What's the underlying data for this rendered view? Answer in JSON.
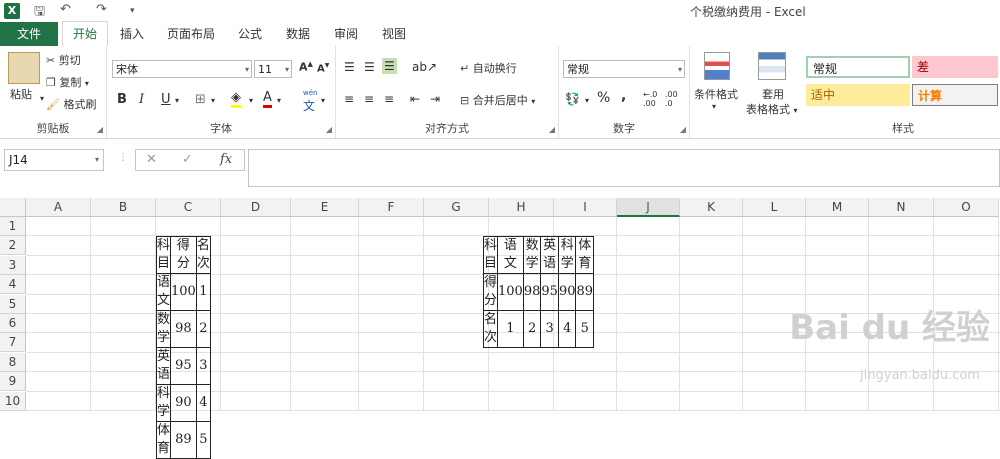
{
  "window": {
    "title": "个税缴纳费用 - Excel",
    "app_icon": "X"
  },
  "tabs": {
    "file": "文件",
    "home": "开始",
    "insert": "插入",
    "layout": "页面布局",
    "formulas": "公式",
    "data": "数据",
    "review": "审阅",
    "view": "视图"
  },
  "clipboard": {
    "paste": "粘贴",
    "cut": "剪切",
    "copy": "复制",
    "format_painter": "格式刷",
    "label": "剪贴板"
  },
  "font": {
    "name": "宋体",
    "size": "11",
    "label": "字体",
    "bold": "B",
    "italic": "I",
    "underline": "U",
    "grow": "A",
    "shrink": "A",
    "fontcolor": "A",
    "phonetic": "文"
  },
  "alignment": {
    "wrap": "自动换行",
    "merge": "合并后居中",
    "label": "对齐方式"
  },
  "number": {
    "format": "常规",
    "percent": "%",
    "comma": ",",
    "label": "数字",
    "inc_dec": ".00",
    "dec_dec": ".0"
  },
  "styles": {
    "cond_format": "条件格式",
    "table_format_l1": "套用",
    "table_format_l2": "表格格式",
    "normal": "常规",
    "bad": "差",
    "neutral": "适中",
    "calc": "计算",
    "label": "样式"
  },
  "formula_bar": {
    "name_box": "J14",
    "fx": "fx",
    "cancel": "✕",
    "enter": "✓"
  },
  "columns": [
    "A",
    "B",
    "C",
    "D",
    "E",
    "F",
    "G",
    "H",
    "I",
    "J",
    "K",
    "L",
    "M",
    "N",
    "O"
  ],
  "rows": [
    "1",
    "2",
    "3",
    "4",
    "5",
    "6",
    "7",
    "8",
    "9",
    "10"
  ],
  "table1": {
    "header": [
      "科目",
      "得分",
      "名次"
    ],
    "rows": [
      [
        "语文",
        "100",
        "1"
      ],
      [
        "数学",
        "98",
        "2"
      ],
      [
        "英语",
        "95",
        "3"
      ],
      [
        "科学",
        "90",
        "4"
      ],
      [
        "体育",
        "89",
        "5"
      ]
    ]
  },
  "table2": {
    "rows": [
      [
        "科目",
        "语文",
        "数学",
        "英语",
        "科学",
        "体育"
      ],
      [
        "得分",
        "100",
        "98",
        "95",
        "90",
        "89"
      ],
      [
        "名次",
        "1",
        "2",
        "3",
        "4",
        "5"
      ]
    ]
  },
  "watermark": {
    "main": "Bai du 经验",
    "url": "jingyan.baidu.com"
  }
}
